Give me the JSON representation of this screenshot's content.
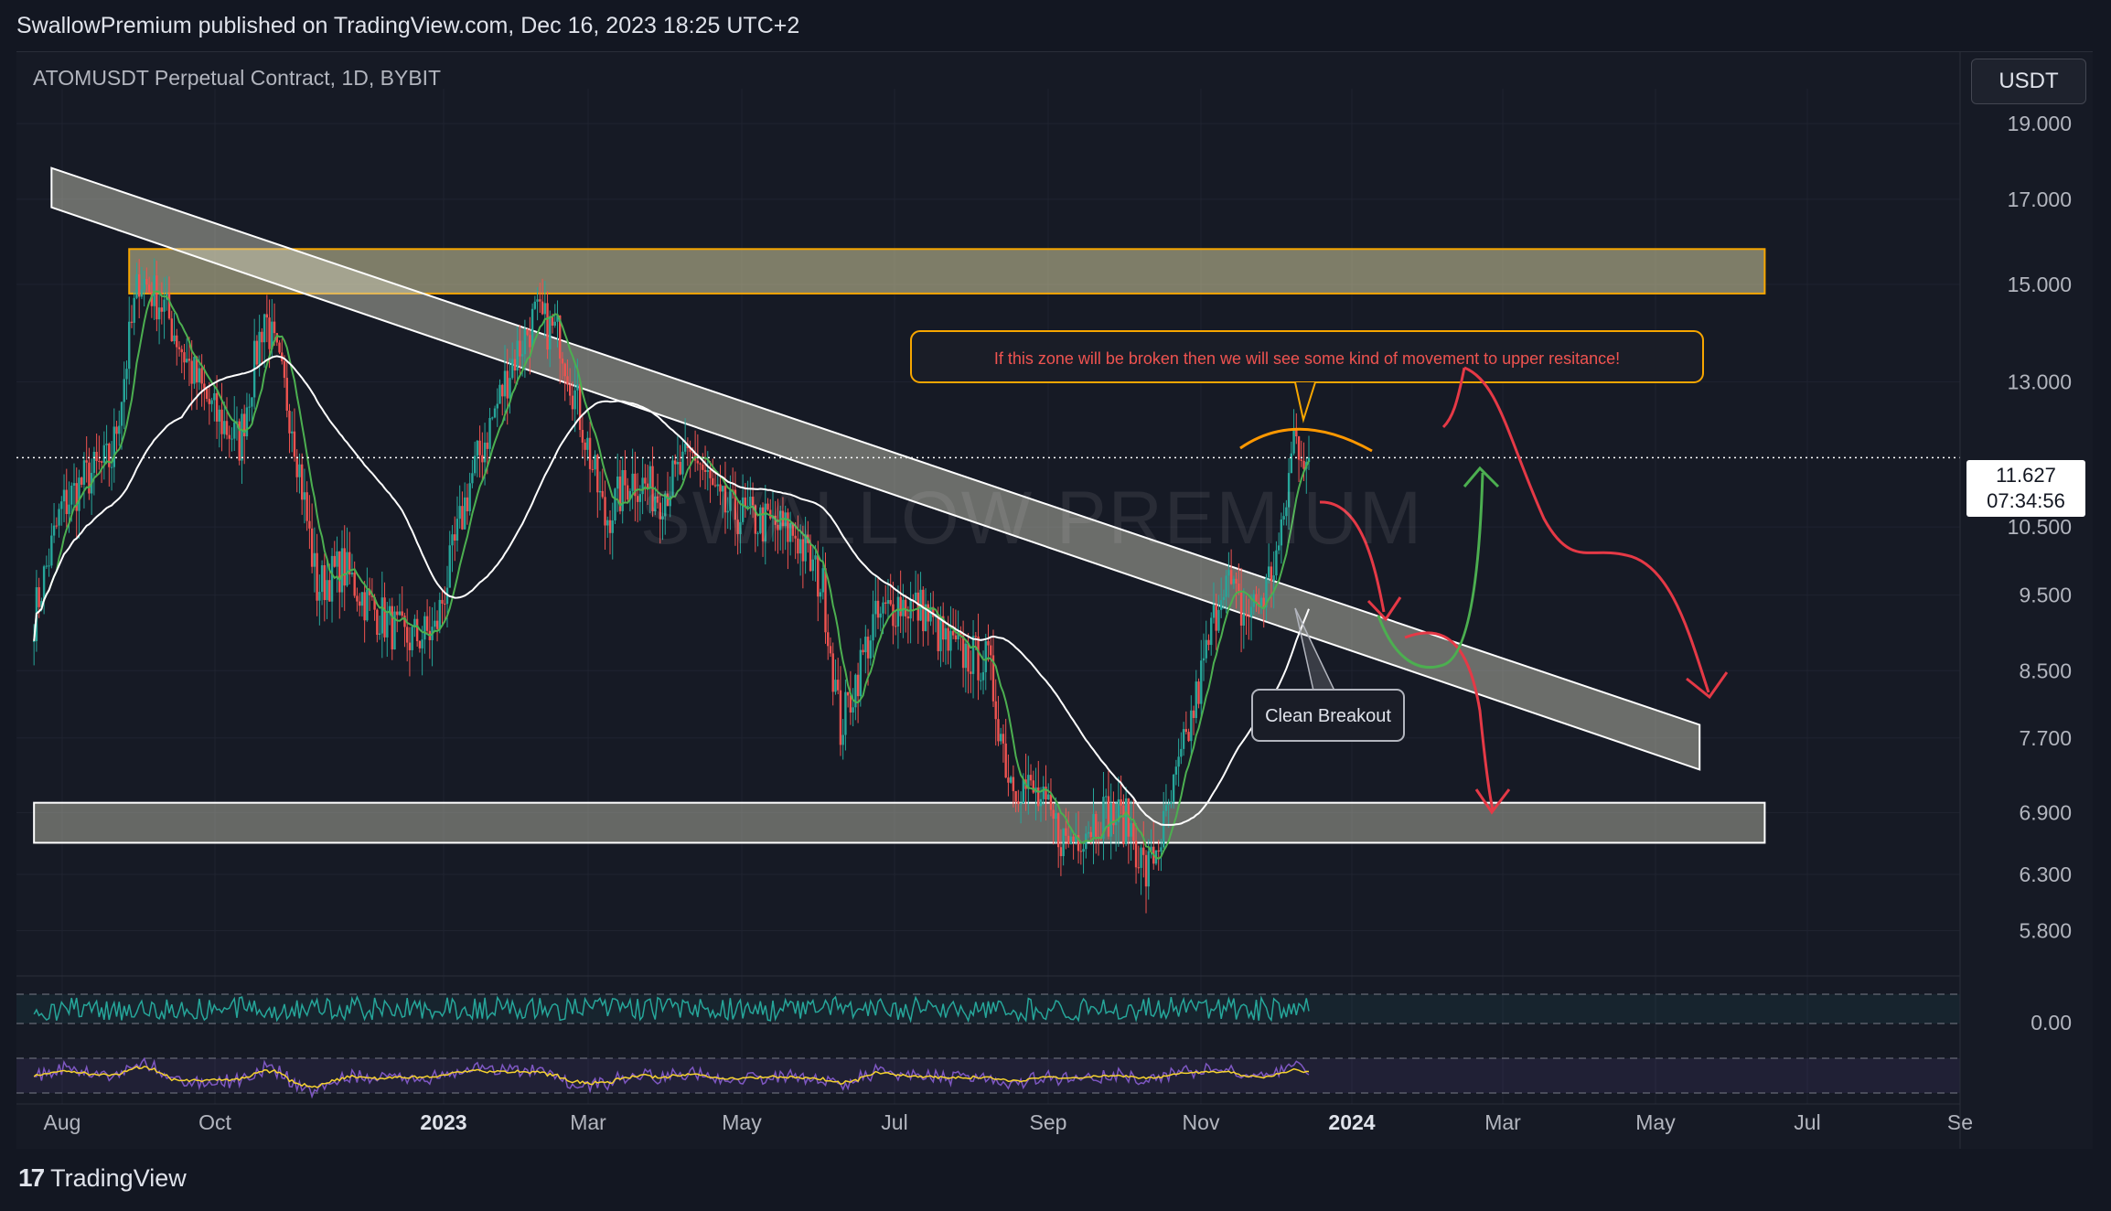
{
  "header": {
    "published_line": "SwallowPremium published on TradingView.com, Dec 16, 2023 18:25 UTC+2"
  },
  "symbol_line": "ATOMUSDT Perpetual Contract, 1D, BYBIT",
  "currency_button": "USDT",
  "watermark": "SWALLOW PREMIUM",
  "last_price": {
    "price": "11.627",
    "countdown": "07:34:56"
  },
  "annotations": {
    "callout": "If this zone will be broken then we will see some kind of movement to upper resitance!",
    "breakout": "Clean Breakout"
  },
  "footer": {
    "brand": "TradingView"
  },
  "colors": {
    "up": "#26a69a",
    "down": "#ef5350",
    "zone": "#f7a600",
    "green_arrow": "#4caf50",
    "red_arrow": "#e53946"
  },
  "chart_data": {
    "type": "candlestick",
    "symbol": "ATOMUSDT",
    "interval": "1D",
    "ylim": [
      5.5,
      20.0
    ],
    "y_scale": "log",
    "y_ticks": [
      "19.000",
      "17.000",
      "15.000",
      "13.000",
      "10.500",
      "9.500",
      "8.500",
      "7.700",
      "6.900",
      "6.300",
      "5.800"
    ],
    "x_ticks": [
      {
        "label": "Aug",
        "bold": false
      },
      {
        "label": "Oct",
        "bold": false
      },
      {
        "label": "2023",
        "bold": true
      },
      {
        "label": "Mar",
        "bold": false
      },
      {
        "label": "May",
        "bold": false
      },
      {
        "label": "Jul",
        "bold": false
      },
      {
        "label": "Sep",
        "bold": false
      },
      {
        "label": "Nov",
        "bold": false
      },
      {
        "label": "2024",
        "bold": true
      },
      {
        "label": "Mar",
        "bold": false
      },
      {
        "label": "May",
        "bold": false
      },
      {
        "label": "Jul",
        "bold": false
      },
      {
        "label": "Se",
        "bold": false
      }
    ],
    "price_path": [
      [
        "2022-07-25",
        9.2
      ],
      [
        "2022-08-05",
        10.8
      ],
      [
        "2022-08-15",
        11.3
      ],
      [
        "2022-08-25",
        11.6
      ],
      [
        "2022-09-05",
        15.2
      ],
      [
        "2022-09-15",
        14.5
      ],
      [
        "2022-09-25",
        13.3
      ],
      [
        "2022-10-05",
        12.4
      ],
      [
        "2022-10-15",
        11.9
      ],
      [
        "2022-10-25",
        14.4
      ],
      [
        "2022-11-05",
        12.3
      ],
      [
        "2022-11-15",
        9.6
      ],
      [
        "2022-11-25",
        9.9
      ],
      [
        "2022-12-05",
        9.4
      ],
      [
        "2022-12-20",
        8.9
      ],
      [
        "2023-01-01",
        9.0
      ],
      [
        "2023-01-15",
        11.2
      ],
      [
        "2023-02-01",
        13.4
      ],
      [
        "2023-02-10",
        14.3
      ],
      [
        "2023-02-20",
        13.9
      ],
      [
        "2023-03-01",
        12.2
      ],
      [
        "2023-03-10",
        10.6
      ],
      [
        "2023-03-20",
        11.3
      ],
      [
        "2023-04-01",
        11.0
      ],
      [
        "2023-04-15",
        11.7
      ],
      [
        "2023-04-25",
        10.8
      ],
      [
        "2023-05-10",
        10.6
      ],
      [
        "2023-05-25",
        10.4
      ],
      [
        "2023-06-05",
        9.6
      ],
      [
        "2023-06-12",
        7.8
      ],
      [
        "2023-06-25",
        9.1
      ],
      [
        "2023-07-05",
        9.4
      ],
      [
        "2023-07-15",
        9.3
      ],
      [
        "2023-07-25",
        8.8
      ],
      [
        "2023-08-10",
        8.6
      ],
      [
        "2023-08-18",
        7.3
      ],
      [
        "2023-08-28",
        7.1
      ],
      [
        "2023-09-10",
        6.6
      ],
      [
        "2023-09-25",
        6.9
      ],
      [
        "2023-10-05",
        6.8
      ],
      [
        "2023-10-12",
        6.3
      ],
      [
        "2023-10-20",
        6.8
      ],
      [
        "2023-10-30",
        7.9
      ],
      [
        "2023-11-05",
        8.7
      ],
      [
        "2023-11-12",
        9.8
      ],
      [
        "2023-11-20",
        9.2
      ],
      [
        "2023-11-28",
        9.5
      ],
      [
        "2023-12-05",
        10.3
      ],
      [
        "2023-12-10",
        12.0
      ],
      [
        "2023-12-16",
        11.627
      ]
    ],
    "zones": [
      {
        "name": "upper resistance",
        "from": "2022-09-01",
        "to": "2024-06-15",
        "low": 14.8,
        "high": 15.8,
        "color": "#f7a600"
      },
      {
        "name": "support",
        "from": "2022-07-25",
        "to": "2024-06-15",
        "low": 6.6,
        "high": 7.0,
        "color": "#ffffff"
      }
    ],
    "trend_channel": {
      "from": {
        "date": "2022-08-01",
        "top": 17.8,
        "bottom": 16.8
      },
      "to": {
        "date": "2024-05-20",
        "top": 7.85,
        "bottom": 7.35
      }
    }
  }
}
